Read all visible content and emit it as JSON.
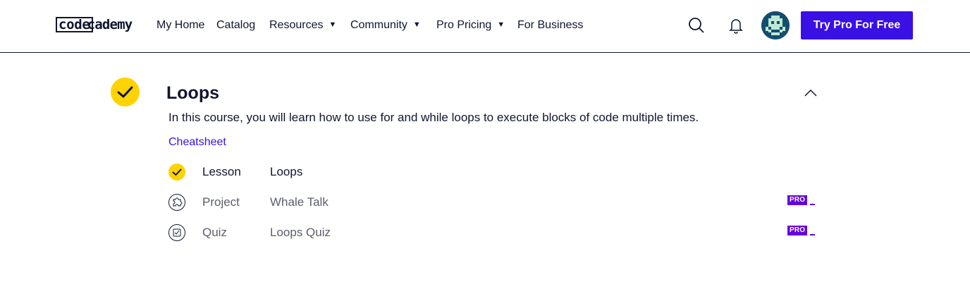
{
  "header": {
    "logo": {
      "code": "code",
      "rest": "cademy"
    },
    "nav": [
      {
        "label": "My Home"
      },
      {
        "label": "Catalog"
      },
      {
        "label": "Resources"
      },
      {
        "label": "Community"
      },
      {
        "label": "Pro Pricing"
      },
      {
        "label": "For Business"
      }
    ],
    "cta_label": "Try Pro For Free",
    "icons": {
      "search": "search-icon",
      "notifications": "bell-icon",
      "avatar": "pixel-avatar"
    }
  },
  "module": {
    "title": "Loops",
    "description": "In this course, you will learn how to use for and while loops to execute blocks of code multiple times.",
    "cheatsheet_label": "Cheatsheet",
    "completed": true,
    "items": [
      {
        "type": "Lesson",
        "name": "Loops",
        "status": "completed",
        "icon": "check-icon"
      },
      {
        "type": "Project",
        "name": "Whale Talk",
        "status": "locked",
        "icon": "puzzle-icon",
        "badge": "PRO"
      },
      {
        "type": "Quiz",
        "name": "Loops Quiz",
        "status": "locked",
        "icon": "quiz-icon",
        "badge": "PRO"
      }
    ]
  },
  "colors": {
    "brand": "#3a10e5",
    "accent": "#ffd300",
    "pro": "#6400e4",
    "text": "#10162f"
  }
}
